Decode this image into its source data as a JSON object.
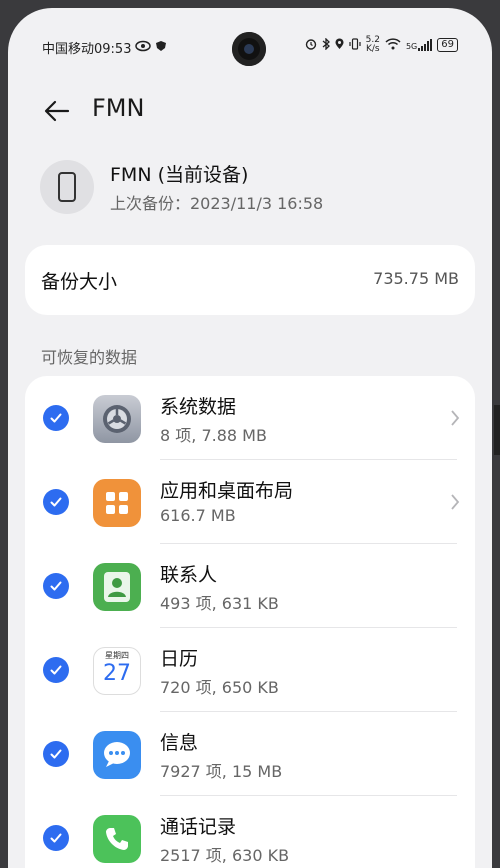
{
  "status_bar": {
    "carrier_time": "中国移动09:53",
    "net_speed_top": "5.2",
    "net_speed_bottom": "K/s",
    "signal_label": "5G",
    "battery": "69"
  },
  "header": {
    "title": "FMN"
  },
  "device": {
    "name": "FMN (当前设备)",
    "last_backup": "上次备份：2023/11/3 16:58"
  },
  "backup_size": {
    "label": "备份大小",
    "value": "735.75 MB"
  },
  "section": {
    "title": "可恢复的数据"
  },
  "calendar_icon": {
    "weekday": "星期四",
    "day": "27"
  },
  "items": [
    {
      "title": "系统数据",
      "subtitle": "8 项, 7.88 MB",
      "icon": "settings-gear-icon",
      "has_chevron": true,
      "checked": true
    },
    {
      "title": "应用和桌面布局",
      "subtitle": "616.7 MB",
      "icon": "app-grid-icon",
      "has_chevron": true,
      "checked": true
    },
    {
      "title": "联系人",
      "subtitle": "493 项, 631 KB",
      "icon": "contacts-icon",
      "has_chevron": false,
      "checked": true
    },
    {
      "title": "日历",
      "subtitle": "720 项, 650 KB",
      "icon": "calendar-icon",
      "has_chevron": false,
      "checked": true
    },
    {
      "title": "信息",
      "subtitle": "7927 项, 15 MB",
      "icon": "messages-icon",
      "has_chevron": false,
      "checked": true
    },
    {
      "title": "通话记录",
      "subtitle": "2517 项, 630 KB",
      "icon": "phone-icon",
      "has_chevron": false,
      "checked": true
    }
  ],
  "colors": {
    "accent": "#2d6cf0",
    "background": "#f1f1f3",
    "card": "#ffffff",
    "apps_orange": "#f0923a",
    "contacts_green": "#4caf50",
    "messages_blue": "#3a8ef0",
    "phone_green": "#4cc25a"
  }
}
